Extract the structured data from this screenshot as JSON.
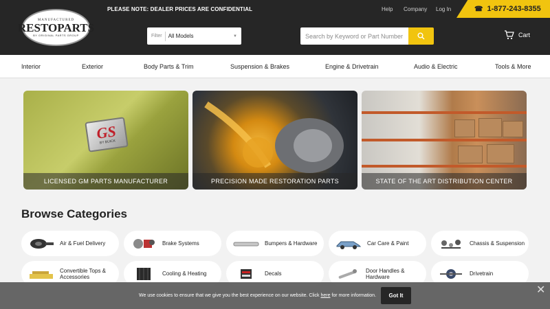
{
  "header": {
    "logo": {
      "top": "MANUFACTURED",
      "main": "RESTOPARTS",
      "bottom": "BY ORIGINAL PARTS GROUP"
    },
    "notice": "PLEASE NOTE: DEALER PRICES ARE CONFIDENTIAL",
    "links": [
      "Help",
      "Company",
      "Log In"
    ],
    "phone": "1-877-243-8355",
    "filter": {
      "label": "Filter",
      "value": "All Models"
    },
    "search": {
      "placeholder": "Search by Keyword or Part Number"
    },
    "cart_label": "Cart"
  },
  "nav": [
    "Interior",
    "Exterior",
    "Body Parts & Trim",
    "Suspension & Brakes",
    "Engine & Drivetrain",
    "Audio & Electric",
    "Tools & More"
  ],
  "hero": {
    "tiles": [
      {
        "caption": "LICENSED GM PARTS MANUFACTURER",
        "badge_main": "GS",
        "badge_sub": "BY BUICK"
      },
      {
        "caption": "PRECISION MADE RESTORATION PARTS"
      },
      {
        "caption": "STATE OF THE ART DISTRIBUTION CENTER"
      }
    ]
  },
  "browse": {
    "title": "Browse Categories",
    "categories": [
      {
        "label": "Air & Fuel Delivery",
        "icon": "air-filter-icon"
      },
      {
        "label": "Brake Systems",
        "icon": "brake-parts-icon"
      },
      {
        "label": "Bumpers & Hardware",
        "icon": "bumper-icon"
      },
      {
        "label": "Car Care & Paint",
        "icon": "car-icon"
      },
      {
        "label": "Chassis & Suspension",
        "icon": "chassis-parts-icon"
      },
      {
        "label": "Convertible Tops & Accessories",
        "icon": "convertible-top-icon"
      },
      {
        "label": "Cooling & Heating",
        "icon": "radiator-icon"
      },
      {
        "label": "Decals",
        "icon": "decal-icon"
      },
      {
        "label": "Door Handles & Hardware",
        "icon": "door-handle-icon"
      },
      {
        "label": "Drivetrain",
        "icon": "drivetrain-icon"
      }
    ]
  },
  "cookie": {
    "text_before": "We use cookies to ensure that we give you the best experience on our website. Click ",
    "link": "here",
    "text_after": " for more information.",
    "button": "Got It",
    "close": "✕"
  },
  "colors": {
    "accent": "#f1c40f",
    "header_bg": "#262626",
    "page_bg": "#f2f2f2"
  }
}
